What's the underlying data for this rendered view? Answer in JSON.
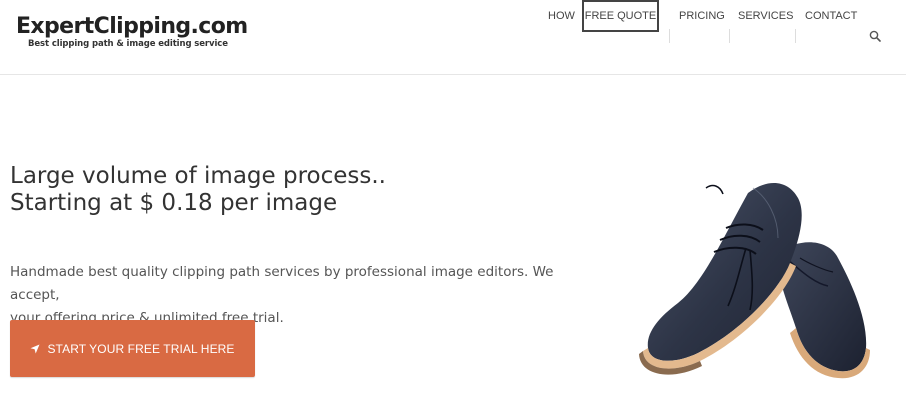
{
  "brand": {
    "name": "ExpertClipping.com",
    "tagline": "Best clipping path & image editing service"
  },
  "nav": {
    "items": [
      {
        "label": "HOW"
      },
      {
        "label": "FREE QUOTE"
      },
      {
        "label": "PRICING"
      },
      {
        "label": "SERVICES"
      },
      {
        "label": "CONTACT"
      }
    ],
    "search_icon": "search-icon"
  },
  "hero": {
    "headline_line1": "Large volume of image process..",
    "headline_line2": "Starting at $ 0.18 per image",
    "description_line1": "Handmade best quality clipping path services by professional image editors. We accept,",
    "description_line2": "your offering price & unlimited free trial.",
    "cta_label": "START YOUR FREE TRIAL HERE",
    "cta_icon": "location-arrow-icon",
    "image": "navy-leather-shoes-photo"
  },
  "colors": {
    "cta": "#d96a43",
    "text": "#333333"
  }
}
